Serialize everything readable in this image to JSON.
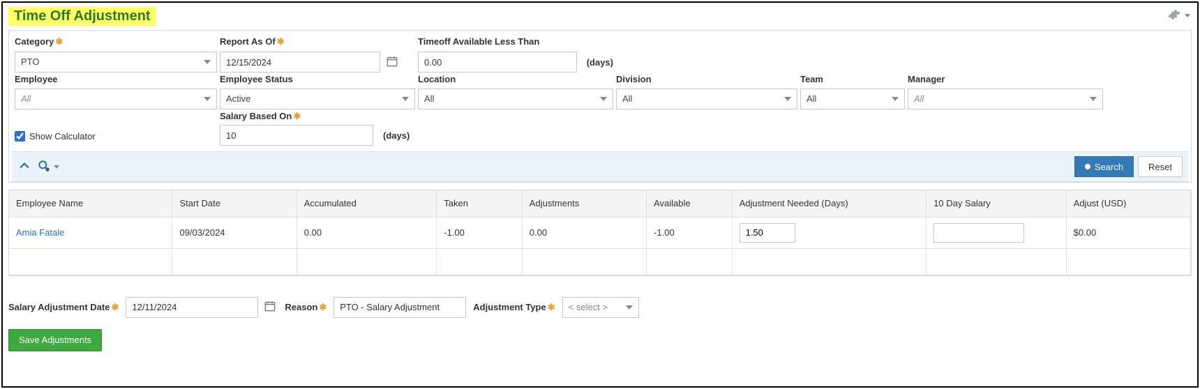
{
  "title": "Time Off Adjustment",
  "filters": {
    "category": {
      "label": "Category",
      "required": true,
      "value": "PTO"
    },
    "reportAsOf": {
      "label": "Report As Of",
      "required": true,
      "value": "12/15/2024"
    },
    "timeoffLess": {
      "label": "Timeoff Available Less Than",
      "value": "0.00",
      "unit": "(days)"
    },
    "employee": {
      "label": "Employee",
      "value": "All"
    },
    "employeeStatus": {
      "label": "Employee Status",
      "value": "Active"
    },
    "location": {
      "label": "Location",
      "value": "All"
    },
    "division": {
      "label": "Division",
      "value": "All"
    },
    "team": {
      "label": "Team",
      "value": "All"
    },
    "manager": {
      "label": "Manager",
      "value": "All"
    },
    "showCalc": {
      "label": "Show Calculator",
      "checked": true
    },
    "salaryBasedOn": {
      "label": "Salary Based On",
      "required": true,
      "value": "10",
      "unit": "(days)"
    }
  },
  "buttons": {
    "search": "Search",
    "reset": "Reset",
    "save": "Save Adjustments"
  },
  "table": {
    "headers": {
      "employeeName": "Employee Name",
      "startDate": "Start Date",
      "accumulated": "Accumulated",
      "taken": "Taken",
      "adjustments": "Adjustments",
      "available": "Available",
      "adjNeeded": "Adjustment Needed (Days)",
      "tenDaySalary": "10 Day Salary",
      "adjustUsd": "Adjust (USD)"
    },
    "rows": [
      {
        "employeeName": "Amia Fatale",
        "startDate": "09/03/2024",
        "accumulated": "0.00",
        "taken": "-1.00",
        "adjustments": "0.00",
        "available": "-1.00",
        "adjNeeded": "1.50",
        "tenDaySalary": "",
        "adjustUsd": "$0.00"
      }
    ]
  },
  "footer": {
    "salaryAdjDate": {
      "label": "Salary Adjustment Date",
      "required": true,
      "value": "12/11/2024"
    },
    "reason": {
      "label": "Reason",
      "required": true,
      "value": "PTO - Salary Adjustment"
    },
    "adjType": {
      "label": "Adjustment Type",
      "required": true,
      "value": "< select >"
    }
  }
}
